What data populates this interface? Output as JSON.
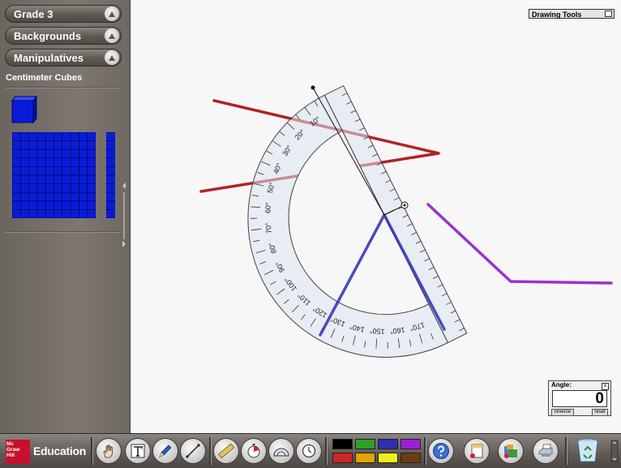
{
  "sidebar": {
    "sections": [
      {
        "label": "Grade 3"
      },
      {
        "label": "Backgrounds"
      },
      {
        "label": "Manipulatives"
      }
    ],
    "manipulatives_title": "Centimeter Cubes"
  },
  "drawing_tools": {
    "label": "Drawing Tools"
  },
  "protractor": {
    "outer_labels": [
      "10°",
      "20°",
      "30°",
      "40°",
      "50°",
      "60°",
      "70°",
      "80°",
      "90°",
      "100°",
      "110°",
      "120°",
      "130°",
      "140°",
      "150°",
      "160°",
      "170°"
    ]
  },
  "angle_panel": {
    "label": "Angle:",
    "close_label": "x",
    "value": "0",
    "reverse_label": "reverse",
    "reset_label": "reset"
  },
  "footer": {
    "logo_text": "Mc Graw Hill",
    "brand": "Education",
    "tools": [
      "hand-tool",
      "text-tool",
      "pen-tool",
      "line-tool",
      "ruler-tool",
      "timer-tool",
      "protractor-tool",
      "clock-tool"
    ],
    "colors": [
      "#000000",
      "#2ca02c",
      "#2b2fb3",
      "#9b1fd6",
      "#d02424",
      "#e3a300",
      "#f2ee1a",
      "#6b3d13"
    ],
    "actions": [
      "help-button",
      "clear-button",
      "save-button",
      "print-button",
      "trash-button"
    ]
  },
  "drawing": {
    "colors": {
      "red": "#b22222",
      "purple": "#9b30d0",
      "blue": "#2b2fb3"
    }
  }
}
